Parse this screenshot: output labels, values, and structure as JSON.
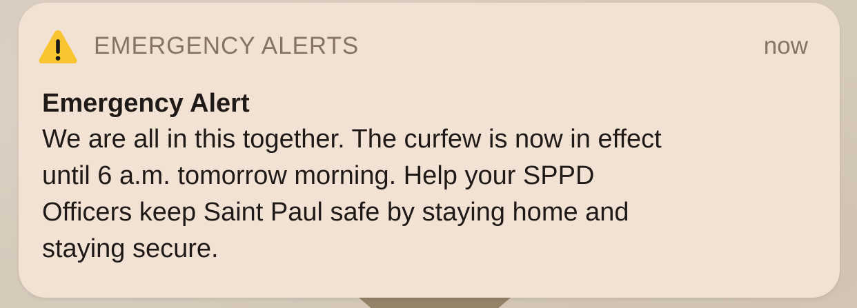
{
  "notification": {
    "app_name": "EMERGENCY ALERTS",
    "timestamp": "now",
    "icon": "warning-triangle-icon",
    "title": "Emergency Alert",
    "body_lines": [
      "We are all in this together. The curfew is now in effect",
      "until 6 a.m. tomorrow morning. Help your SPPD",
      "Officers keep Saint Paul safe by staying home and",
      "staying secure."
    ]
  },
  "colors": {
    "card_background": "#f2e2d4",
    "header_text": "#857465",
    "body_text": "#1f1a17",
    "warning_yellow": "#f8c531"
  }
}
